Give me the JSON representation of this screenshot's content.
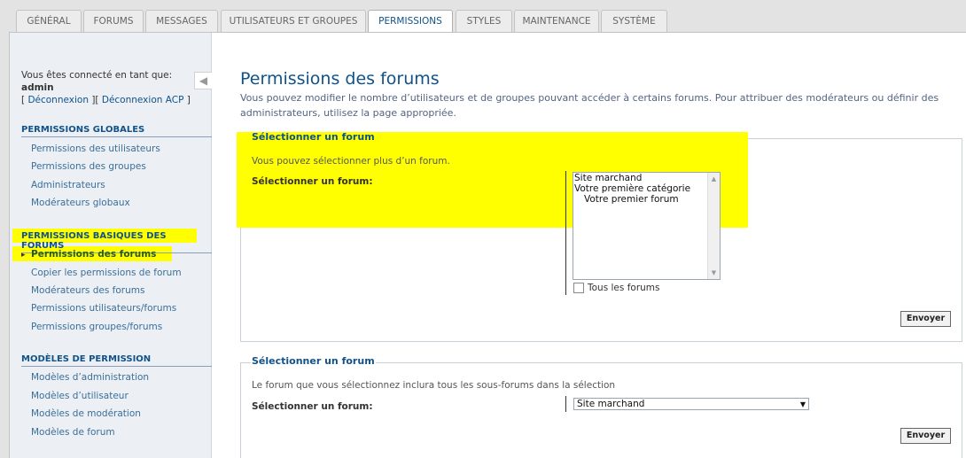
{
  "tabs": [
    {
      "label": "Général"
    },
    {
      "label": "Forums"
    },
    {
      "label": "Messages"
    },
    {
      "label": "Utilisateurs et groupes"
    },
    {
      "label": "Permissions",
      "active": true
    },
    {
      "label": "Styles"
    },
    {
      "label": "Maintenance"
    },
    {
      "label": "Système"
    }
  ],
  "sidebar": {
    "logged_in_text": "Vous êtes connecté en tant que:",
    "username": "admin",
    "logout_link": "Déconnexion",
    "logout_acp_link": "Déconnexion ACP",
    "collapse_icon": "arrow-left-icon",
    "sections": [
      {
        "title": "Permissions globales",
        "items": [
          "Permissions des utilisateurs",
          "Permissions des groupes",
          "Administrateurs",
          "Modérateurs globaux"
        ]
      },
      {
        "title": "Permissions basiques des forums",
        "items": [
          "Permissions des forums",
          "Copier les permissions de forum",
          "Modérateurs des forums",
          "Permissions utilisateurs/forums",
          "Permissions groupes/forums"
        ]
      },
      {
        "title": "Modèles de permission",
        "items": [
          "Modèles d’administration",
          "Modèles d’utilisateur",
          "Modèles de modération",
          "Modèles de forum"
        ]
      }
    ]
  },
  "main": {
    "title": "Permissions des forums",
    "intro": "Vous pouvez modifier le nombre d’utilisateurs et de groupes pouvant accéder à certains forums. Pour attribuer des modérateurs ou définir des administrateurs, utilisez la page appropriée.",
    "box1": {
      "legend": "Sélectionner un forum",
      "hint": "Vous pouvez sélectionner plus d’un forum.",
      "label": "Sélectionner un forum:",
      "options": [
        "Site marchand",
        "Votre première catégorie",
        "Votre premier forum"
      ],
      "all_forums_label": "Tous les forums",
      "submit": "Envoyer"
    },
    "box2": {
      "legend": "Sélectionner un forum",
      "hint": "Le forum que vous sélectionnez inclura tous les sous-forums dans la sélection",
      "label": "Sélectionner un forum:",
      "selected": "Site marchand",
      "submit": "Envoyer"
    }
  },
  "colors": {
    "highlight": "#ffff00",
    "accent": "#105289"
  }
}
